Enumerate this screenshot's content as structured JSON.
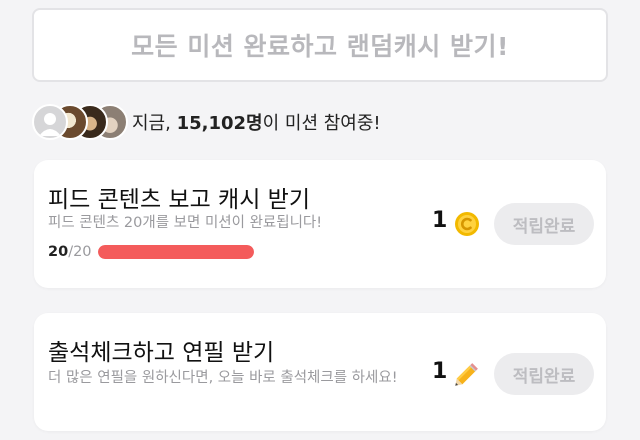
{
  "banner": {
    "label": "모든 미션 완료하고 랜덤캐시 받기!"
  },
  "participants": {
    "prefix": "지금, ",
    "count": "15,102명",
    "suffix": "이 미션 참여중!",
    "avatars": [
      "default-avatar",
      "user-avatar",
      "user-avatar",
      "user-avatar"
    ]
  },
  "missions": [
    {
      "title": "피드 콘텐츠 보고 캐시 받기",
      "description": "피드 콘텐츠 20개를 보면 미션이 완료됩니다!",
      "progress_done": "20",
      "progress_total": "/20",
      "progress_fraction": 1.0,
      "reward_count": "1",
      "reward_icon": "cash-coin-icon",
      "button_label": "적립완료"
    },
    {
      "title": "출석체크하고 연필 받기",
      "description": "더 많은 연필을 원하신다면, 오늘 바로 출석체크를 하세요!",
      "reward_count": "1",
      "reward_icon": "pencil-icon",
      "button_label": "적립완료"
    }
  ],
  "colors": {
    "progress": "#f45b5b",
    "coin": "#f2b900",
    "disabled_button_bg": "#ececee",
    "disabled_button_text": "#bdbdc1"
  }
}
